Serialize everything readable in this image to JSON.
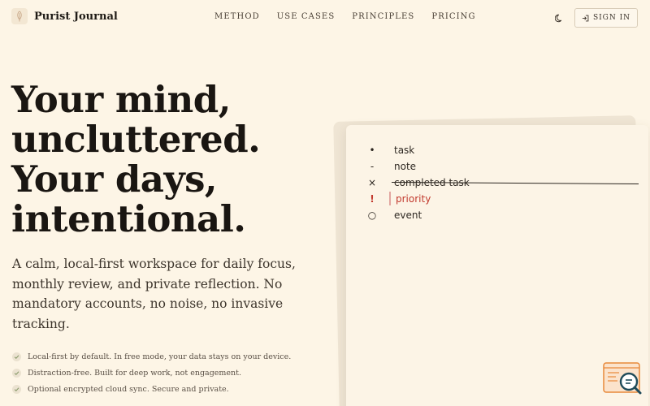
{
  "brand": {
    "name": "Purist Journal"
  },
  "nav": {
    "items": [
      "METHOD",
      "USE CASES",
      "PRINCIPLES",
      "PRICING"
    ]
  },
  "header": {
    "theme_icon": "moon-icon",
    "signin_label": "SIGN IN",
    "signin_icon": "sign-in-icon"
  },
  "hero": {
    "title_lines": [
      "Your mind,",
      "uncluttered.",
      "Your days,",
      "intentional."
    ],
    "subtitle": "A calm, local-first workspace for daily focus, monthly review, and private reflection. No mandatory accounts, no noise, no invasive tracking.",
    "features": [
      "Local-first by default. In free mode, your data stays on your device.",
      "Distraction-free. Built for deep work, not engagement.",
      "Optional encrypted cloud sync. Secure and private."
    ]
  },
  "journal": {
    "entries": [
      {
        "symbol": "•",
        "label": "task",
        "style": "normal"
      },
      {
        "symbol": "-",
        "label": "note",
        "style": "normal"
      },
      {
        "symbol": "×",
        "label": "completed task",
        "style": "completed"
      },
      {
        "symbol": "!",
        "label": "priority",
        "style": "priority"
      },
      {
        "symbol": "○",
        "label": "event",
        "style": "normal"
      }
    ]
  },
  "colors": {
    "background": "#fdf5e6",
    "text": "#1f1b16",
    "priority": "#c23a2e",
    "widget_accent": "#e8893a",
    "widget_dark": "#1f4b5a"
  }
}
